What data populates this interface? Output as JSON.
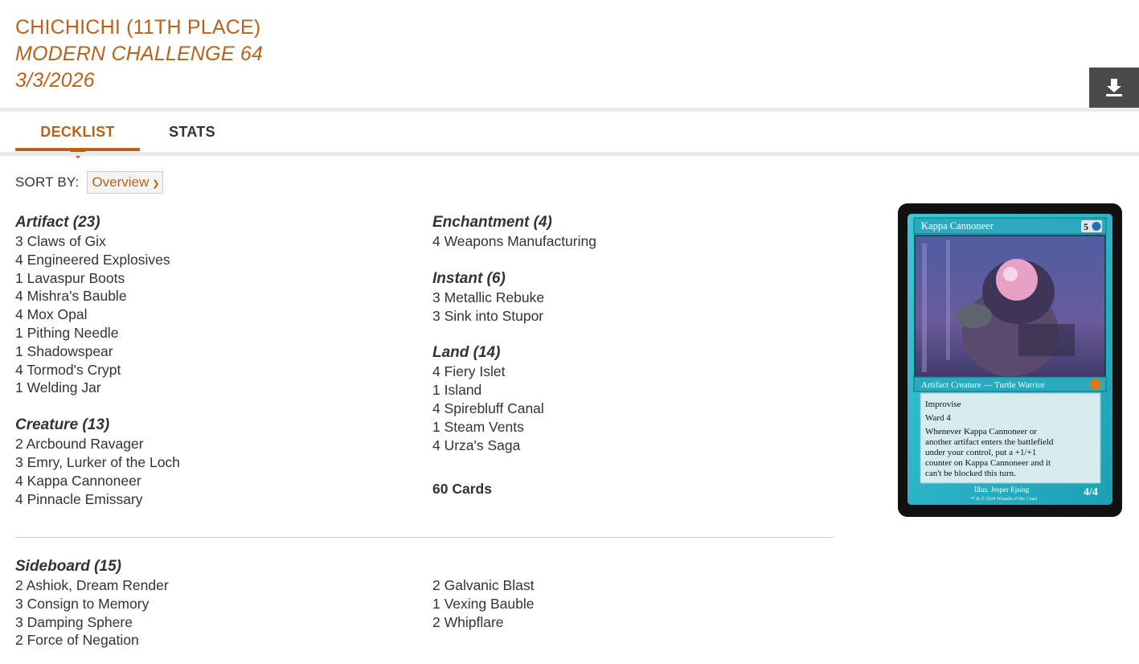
{
  "header": {
    "player": "CHICHICHI (11TH PLACE)",
    "event": "MODERN CHALLENGE 64",
    "date": "3/3/2026"
  },
  "download": {
    "icon": "download-icon"
  },
  "tabs": [
    {
      "label": "DECKLIST",
      "active": true
    },
    {
      "label": "STATS",
      "active": false
    }
  ],
  "sort": {
    "label": "SORT BY:",
    "selected": "Overview"
  },
  "left_groups": [
    {
      "title": "Artifact (23)",
      "cards": [
        "3 Claws of Gix",
        "4 Engineered Explosives",
        "1 Lavaspur Boots",
        "4 Mishra's Bauble",
        "4 Mox Opal",
        "1 Pithing Needle",
        "1 Shadowspear",
        "4 Tormod's Crypt",
        "1 Welding Jar"
      ]
    },
    {
      "title": "Creature (13)",
      "cards": [
        "2 Arcbound Ravager",
        "3 Emry, Lurker of the Loch",
        "4 Kappa Cannoneer",
        "4 Pinnacle Emissary"
      ]
    }
  ],
  "right_groups": [
    {
      "title": "Enchantment (4)",
      "cards": [
        "4 Weapons Manufacturing"
      ]
    },
    {
      "title": "Instant (6)",
      "cards": [
        "3 Metallic Rebuke",
        "3 Sink into Stupor"
      ]
    },
    {
      "title": "Land (14)",
      "cards": [
        "4 Fiery Islet",
        "1 Island",
        "4 Spirebluff Canal",
        "1 Steam Vents",
        "4 Urza's Saga"
      ]
    }
  ],
  "total": "60 Cards",
  "sideboard": {
    "title": "Sideboard (15)",
    "left": [
      "2 Ashiok, Dream Render",
      "3 Consign to Memory",
      "3 Damping Sphere",
      "2 Force of Negation"
    ],
    "right": [
      "2 Galvanic Blast",
      "1 Vexing Bauble",
      "2 Whipflare"
    ]
  },
  "preview_card": {
    "name": "Kappa Cannoneer",
    "cost": "5",
    "type_line": "Artifact Creature — Turtle Warrior",
    "rules": [
      "Improvise",
      "Ward 4",
      "Whenever Kappa Cannoneer or",
      "another artifact enters the battlefield",
      "under your control, put a +1/+1",
      "counter on Kappa Cannoneer and it",
      "can't be blocked this turn."
    ],
    "illustrator": "Illus. Jesper Ejsing",
    "copyright": "™ & © 2024 Wizards of the Coast",
    "pt": "4/4"
  },
  "colors": {
    "accent": "#b8621b",
    "text": "#333333",
    "button": "#4a4a4a"
  }
}
